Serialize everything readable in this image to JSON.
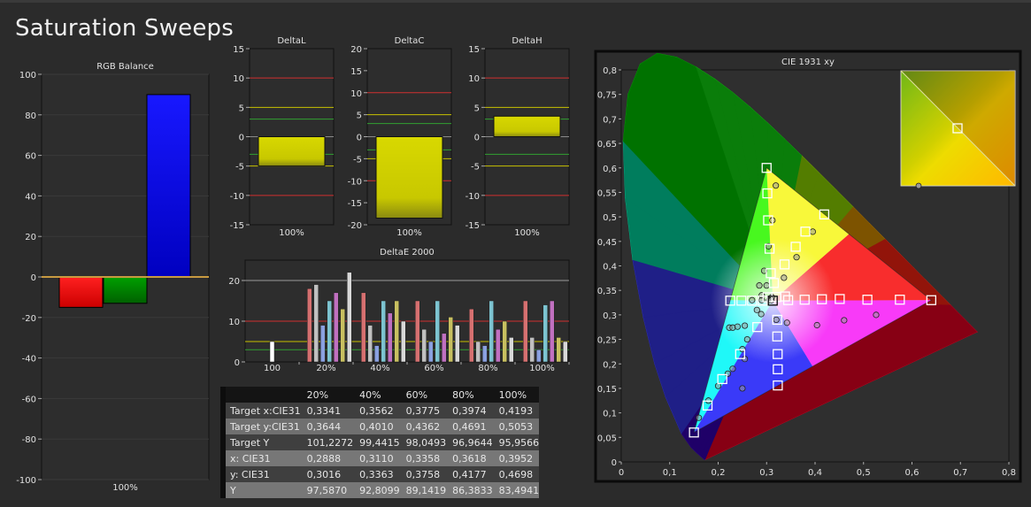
{
  "page": {
    "title": "Saturation Sweeps"
  },
  "chart_data": [
    {
      "id": "rgb",
      "type": "bar",
      "title": "RGB Balance",
      "categories": [
        "R",
        "G",
        "B"
      ],
      "values": [
        -15,
        -13,
        90
      ],
      "colors": [
        "#ff0000",
        "#009000",
        "#0000ff"
      ],
      "xlabel": "100%",
      "ylim": [
        -100,
        100
      ],
      "yticks": [
        100,
        80,
        60,
        40,
        20,
        0,
        -20,
        -40,
        -60,
        -80,
        -100
      ]
    },
    {
      "id": "dl",
      "type": "bar",
      "title": "DeltaL",
      "values": [
        -5
      ],
      "xlabel": "100%",
      "ylim": [
        -15,
        15
      ],
      "yticks": [
        15,
        10,
        5,
        0,
        -5,
        -10,
        -15
      ]
    },
    {
      "id": "dc",
      "type": "bar",
      "title": "DeltaC",
      "values": [
        -18.5
      ],
      "xlabel": "100%",
      "ylim": [
        -20,
        20
      ],
      "yticks": [
        20,
        15,
        10,
        5,
        0,
        -5,
        -10,
        -15,
        -20
      ]
    },
    {
      "id": "dh",
      "type": "bar",
      "title": "DeltaH",
      "values": [
        3.5
      ],
      "xlabel": "100%",
      "ylim": [
        -15,
        15
      ],
      "yticks": [
        15,
        10,
        5,
        0,
        -5,
        -10,
        -15
      ]
    },
    {
      "id": "de",
      "type": "bar",
      "title": "DeltaE 2000",
      "categories": [
        "100",
        "20%",
        "40%",
        "60%",
        "80%",
        "100%"
      ],
      "ylim": [
        0,
        25
      ],
      "yticks": [
        20,
        10,
        0
      ],
      "series": [
        {
          "color": "#ffffff",
          "values": [
            5,
            0,
            0,
            0,
            0,
            0
          ]
        },
        {
          "color": "#d67070",
          "values": [
            0,
            18,
            17,
            15,
            13,
            15
          ]
        },
        {
          "color": "#c0c0c0",
          "values": [
            0,
            19,
            9,
            8,
            5,
            6
          ]
        },
        {
          "color": "#8aa0e0",
          "values": [
            0,
            9,
            4,
            5,
            4,
            3
          ]
        },
        {
          "color": "#7cc3d0",
          "values": [
            0,
            15,
            15,
            15,
            15,
            14
          ]
        },
        {
          "color": "#c070c0",
          "values": [
            0,
            17,
            12,
            7,
            8,
            15
          ]
        },
        {
          "color": "#c8c060",
          "values": [
            0,
            13,
            15,
            11,
            10,
            6
          ]
        },
        {
          "color": "#d8d8d8",
          "values": [
            0,
            22,
            10,
            9,
            6,
            5
          ]
        }
      ]
    },
    {
      "id": "cie",
      "type": "scatter",
      "title": "CIE 1931 xy",
      "xlim": [
        0,
        0.8
      ],
      "ylim": [
        0,
        0.8
      ],
      "xticks": [
        0,
        0.1,
        0.2,
        0.3,
        0.4,
        0.5,
        0.6,
        0.7,
        0.8
      ],
      "yticks": [
        0.8,
        0.75,
        0.7,
        0.65,
        0.6,
        0.55,
        0.5,
        0.45,
        0.4,
        0.35,
        0.3,
        0.25,
        0.2,
        0.15,
        0.1,
        0.05,
        0
      ],
      "gamut": [
        [
          0.64,
          0.33
        ],
        [
          0.3,
          0.6
        ],
        [
          0.15,
          0.06
        ]
      ],
      "white": [
        0.3127,
        0.329
      ],
      "targets": [
        [
          0.3127,
          0.329
        ],
        [
          0.3444,
          0.3301
        ],
        [
          0.3785,
          0.331
        ],
        [
          0.4141,
          0.3319
        ],
        [
          0.4509,
          0.3324
        ],
        [
          0.6399,
          0.33
        ],
        [
          0.3086,
          0.3851
        ],
        [
          0.3061,
          0.435
        ],
        [
          0.3031,
          0.493
        ],
        [
          0.3015,
          0.548
        ],
        [
          0.3,
          0.6
        ],
        [
          0.2808,
          0.2751
        ],
        [
          0.2453,
          0.22
        ],
        [
          0.2085,
          0.169
        ],
        [
          0.1781,
          0.115
        ],
        [
          0.15,
          0.06
        ],
        [
          0.302,
          0.3358
        ],
        [
          0.32,
          0.3364
        ],
        [
          0.338,
          0.3376
        ],
        [
          0.322,
          0.29
        ],
        [
          0.322,
          0.256
        ],
        [
          0.3228,
          0.22
        ],
        [
          0.323,
          0.189
        ],
        [
          0.3231,
          0.156
        ],
        [
          0.315,
          0.365
        ],
        [
          0.337,
          0.403
        ],
        [
          0.36,
          0.439
        ],
        [
          0.38,
          0.47
        ],
        [
          0.419,
          0.505
        ],
        [
          0.292,
          0.329
        ],
        [
          0.27,
          0.329
        ],
        [
          0.248,
          0.329
        ],
        [
          0.225,
          0.329
        ],
        [
          0.508,
          0.331
        ],
        [
          0.575,
          0.331
        ]
      ],
      "measured": [
        [
          0.2888,
          0.3016
        ],
        [
          0.311,
          0.3363
        ],
        [
          0.3358,
          0.3758
        ],
        [
          0.3618,
          0.4177
        ],
        [
          0.3952,
          0.4698
        ],
        [
          0.304,
          0.44
        ],
        [
          0.312,
          0.493
        ],
        [
          0.319,
          0.564
        ],
        [
          0.32,
          0.29
        ],
        [
          0.342,
          0.284
        ],
        [
          0.404,
          0.279
        ],
        [
          0.46,
          0.289
        ],
        [
          0.526,
          0.3
        ],
        [
          0.223,
          0.274
        ],
        [
          0.23,
          0.274
        ],
        [
          0.24,
          0.276
        ],
        [
          0.255,
          0.278
        ],
        [
          0.25,
          0.23
        ],
        [
          0.23,
          0.19
        ],
        [
          0.22,
          0.18
        ],
        [
          0.2,
          0.155
        ],
        [
          0.18,
          0.125
        ],
        [
          0.16,
          0.09
        ],
        [
          0.26,
          0.25
        ],
        [
          0.255,
          0.21
        ],
        [
          0.25,
          0.15
        ],
        [
          0.28,
          0.31
        ],
        [
          0.29,
          0.33
        ],
        [
          0.305,
          0.33
        ],
        [
          0.31,
          0.33
        ],
        [
          0.29,
          0.34
        ],
        [
          0.27,
          0.33
        ],
        [
          0.3,
          0.36
        ],
        [
          0.295,
          0.39
        ],
        [
          0.285,
          0.36
        ]
      ]
    }
  ],
  "table": {
    "header": [
      "",
      "20%",
      "40%",
      "60%",
      "80%",
      "100%"
    ],
    "rows": [
      [
        "Target x:CIE31",
        "0,3341",
        "0,3562",
        "0,3775",
        "0,3974",
        "0,4193"
      ],
      [
        "Target y:CIE31",
        "0,3644",
        "0,4010",
        "0,4362",
        "0,4691",
        "0,5053"
      ],
      [
        "Target Y",
        "101,2272",
        "99,4415",
        "98,0493",
        "96,9644",
        "95,9566"
      ],
      [
        "x: CIE31",
        "0,2888",
        "0,3110",
        "0,3358",
        "0,3618",
        "0,3952"
      ],
      [
        "y: CIE31",
        "0,3016",
        "0,3363",
        "0,3758",
        "0,4177",
        "0,4698"
      ],
      [
        "Y",
        "97,5870",
        "92,8099",
        "89,1419",
        "86,3833",
        "83,4941"
      ]
    ]
  }
}
